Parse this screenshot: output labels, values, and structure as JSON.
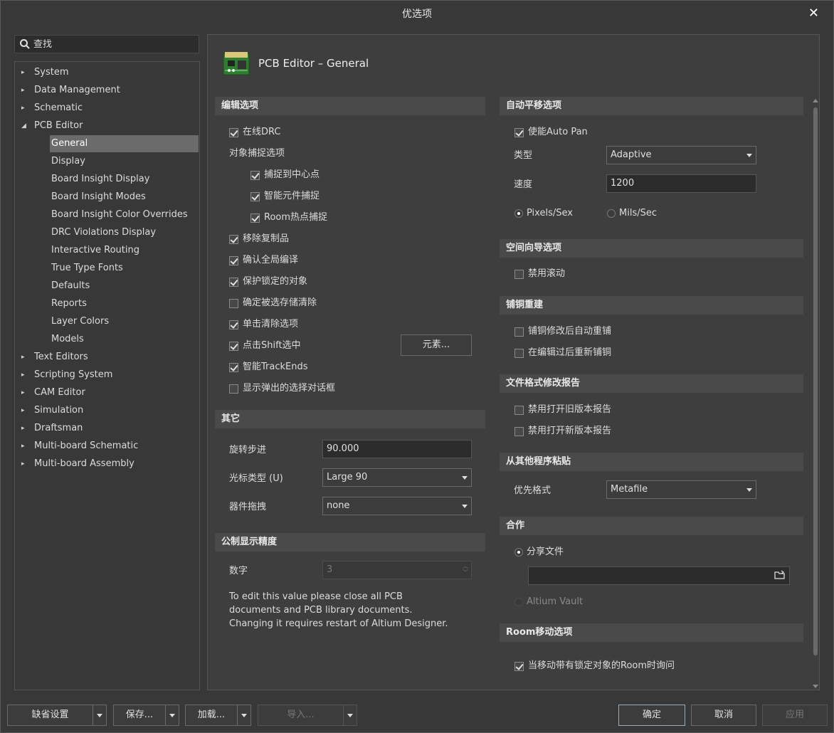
{
  "window": {
    "title": "优选项"
  },
  "search": {
    "placeholder": "查找"
  },
  "tree": [
    {
      "label": "System",
      "level": 0,
      "arrow": "▸"
    },
    {
      "label": "Data Management",
      "level": 0,
      "arrow": "▸"
    },
    {
      "label": "Schematic",
      "level": 0,
      "arrow": "▸"
    },
    {
      "label": "PCB Editor",
      "level": 0,
      "arrow": "◢"
    },
    {
      "label": "General",
      "level": 1,
      "selected": true
    },
    {
      "label": "Display",
      "level": 1
    },
    {
      "label": "Board Insight Display",
      "level": 1
    },
    {
      "label": "Board Insight Modes",
      "level": 1
    },
    {
      "label": "Board Insight Color Overrides",
      "level": 1
    },
    {
      "label": "DRC Violations Display",
      "level": 1
    },
    {
      "label": "Interactive Routing",
      "level": 1
    },
    {
      "label": "True Type Fonts",
      "level": 1
    },
    {
      "label": "Defaults",
      "level": 1
    },
    {
      "label": "Reports",
      "level": 1
    },
    {
      "label": "Layer Colors",
      "level": 1
    },
    {
      "label": "Models",
      "level": 1
    },
    {
      "label": "Text Editors",
      "level": 0,
      "arrow": "▸"
    },
    {
      "label": "Scripting System",
      "level": 0,
      "arrow": "▸"
    },
    {
      "label": "CAM Editor",
      "level": 0,
      "arrow": "▸"
    },
    {
      "label": "Simulation",
      "level": 0,
      "arrow": "▸"
    },
    {
      "label": "Draftsman",
      "level": 0,
      "arrow": "▸"
    },
    {
      "label": "Multi-board Schematic",
      "level": 0,
      "arrow": "▸"
    },
    {
      "label": "Multi-board Assembly",
      "level": 0,
      "arrow": "▸"
    }
  ],
  "page": {
    "title": "PCB Editor – General"
  },
  "editing": {
    "header": "编辑选项",
    "online_drc": {
      "label": "在线DRC",
      "checked": true
    },
    "snap_header": "对象捕捉选项",
    "snap_center": {
      "label": "捕捉到中心点",
      "checked": true
    },
    "smart_snap": {
      "label": "智能元件捕捉",
      "checked": true
    },
    "room_hotspot": {
      "label": "Room热点捕捉",
      "checked": true
    },
    "remove_dup": {
      "label": "移除复制品",
      "checked": true
    },
    "confirm_global": {
      "label": "确认全局编译",
      "checked": true
    },
    "protect_locked": {
      "label": "保护锁定的对象",
      "checked": true
    },
    "confirm_clear": {
      "label": "确定被选存储清除",
      "checked": false
    },
    "click_clear": {
      "label": "单击清除选项",
      "checked": true
    },
    "shift_select": {
      "label": "点击Shift选中",
      "checked": true
    },
    "elements_button": "元素...",
    "smart_trackends": {
      "label": "智能TrackEnds",
      "checked": true
    },
    "show_popup": {
      "label": "显示弹出的选择对话框",
      "checked": false
    }
  },
  "other": {
    "header": "其它",
    "rotation_label": "旋转步进",
    "rotation_value": "90.000",
    "cursor_label": "光标类型 (U)",
    "cursor_value": "Large 90",
    "drag_label": "器件拖拽",
    "drag_value": "none"
  },
  "metric": {
    "header": "公制显示精度",
    "digits_label": "数字",
    "digits_value": "3",
    "note": "To edit this value please close all PCB documents and PCB library documents. Changing it requires restart of Altium Designer."
  },
  "autopan": {
    "header": "自动平移选项",
    "enable": {
      "label": "使能Auto Pan",
      "checked": true
    },
    "type_label": "类型",
    "type_value": "Adaptive",
    "speed_label": "速度",
    "speed_value": "1200",
    "pixels": {
      "label": "Pixels/Sex",
      "checked": true
    },
    "mils": {
      "label": "Mils/Sec",
      "checked": false
    }
  },
  "spaceNav": {
    "header": "空间向导选项",
    "disable_roll": {
      "label": "禁用滚动",
      "checked": false
    }
  },
  "polygon": {
    "header": "铺铜重建",
    "auto_repour": {
      "label": "铺铜修改后自动重铺",
      "checked": false
    },
    "repour_after_edit": {
      "label": "在编辑过后重新铺铜",
      "checked": false
    }
  },
  "fileFormat": {
    "header": "文件格式修改报告",
    "disable_old": {
      "label": "禁用打开旧版本报告",
      "checked": false
    },
    "disable_new": {
      "label": "禁用打开新版本报告",
      "checked": false
    }
  },
  "paste": {
    "header": "从其他程序粘贴",
    "pref_label": "优先格式",
    "pref_value": "Metafile"
  },
  "collab": {
    "header": "合作",
    "shared": {
      "label": "分享文件",
      "checked": true
    },
    "path_value": "",
    "vault": {
      "label": "Altium Vault",
      "checked": false
    }
  },
  "room": {
    "header": "Room移动选项",
    "ask_locked": {
      "label": "当移动带有锁定对象的Room时询问",
      "checked": true
    }
  },
  "footer": {
    "defaults": "缺省设置",
    "save": "保存...",
    "load": "加载...",
    "import": "导入...",
    "ok": "确定",
    "cancel": "取消",
    "apply": "应用"
  }
}
